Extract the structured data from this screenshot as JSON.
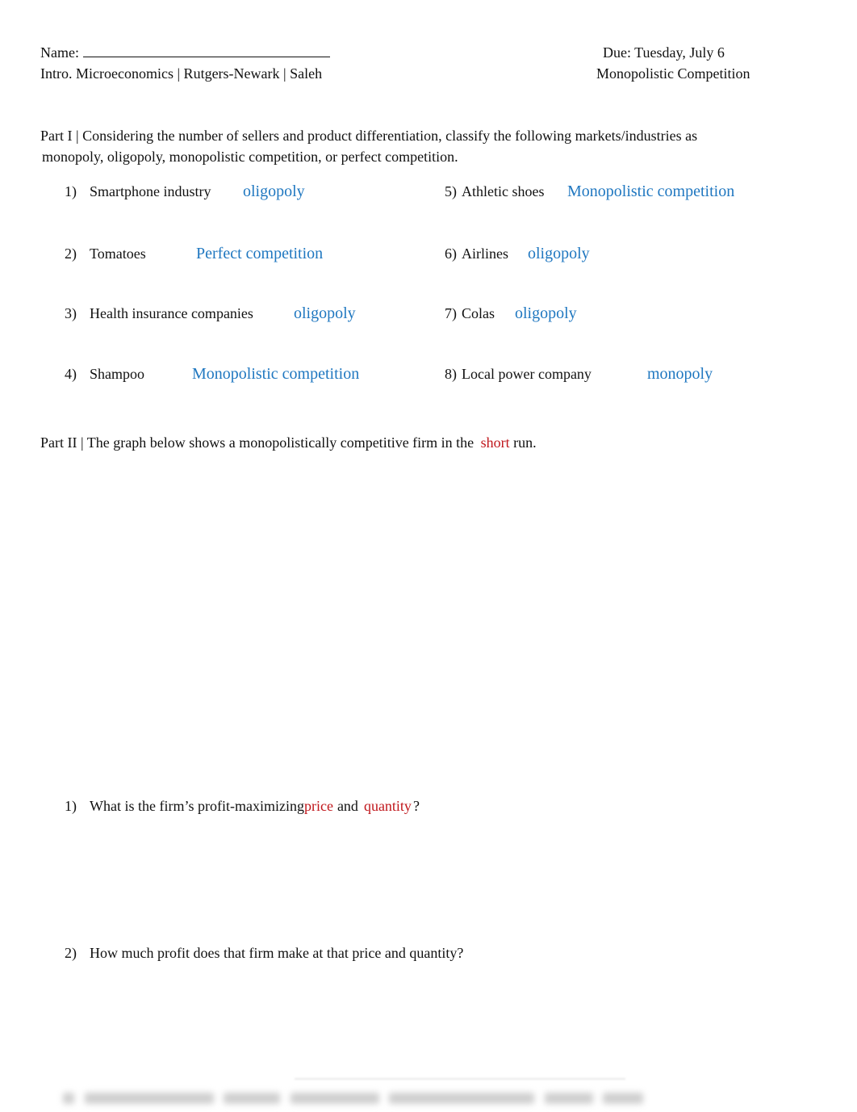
{
  "header": {
    "name_label": "Name:",
    "due": "Due: Tuesday, July 6",
    "course": "Intro. Microeconomics | Rutgers-Newark | Saleh",
    "topic": "Monopolistic Competition"
  },
  "part1": {
    "prompt_line1": "Part I | Considering the number of sellers and product differentiation, classify the following markets/industries as",
    "prompt_line2": "monopoly, oligopoly, monopolistic competition, or perfect competition.",
    "items": [
      {
        "num": "1)",
        "label": "Smartphone industry",
        "answer": "oligopoly"
      },
      {
        "num": "2)",
        "label": "Tomatoes",
        "answer": "Perfect competition"
      },
      {
        "num": "3)",
        "label": "Health insurance companies",
        "answer": "oligopoly"
      },
      {
        "num": "4)",
        "label": "Shampoo",
        "answer": "Monopolistic competition"
      },
      {
        "num": "5)",
        "label": "Athletic shoes",
        "answer": "Monopolistic competition"
      },
      {
        "num": "6)",
        "label": "Airlines",
        "answer": "oligopoly"
      },
      {
        "num": "7)",
        "label": "Colas",
        "answer": "oligopoly"
      },
      {
        "num": "8)",
        "label": "Local power company",
        "answer": "monopoly"
      }
    ]
  },
  "part2": {
    "prompt_before": "Part II | The graph below shows a monopolistically competitive firm in the",
    "prompt_highlight": "short",
    "prompt_after": "run.",
    "questions": [
      {
        "num": "1)",
        "text_before": "What is the firm’s profit-maximizing",
        "highlight1": "price",
        "text_mid": "and",
        "highlight2": "quantity",
        "text_after": "?"
      },
      {
        "num": "2)",
        "text": "How much profit does that firm make at that price and quantity?"
      }
    ]
  },
  "colors": {
    "answer_blue": "#1f77c0",
    "highlight_red": "#c0161b",
    "text": "#111111"
  }
}
